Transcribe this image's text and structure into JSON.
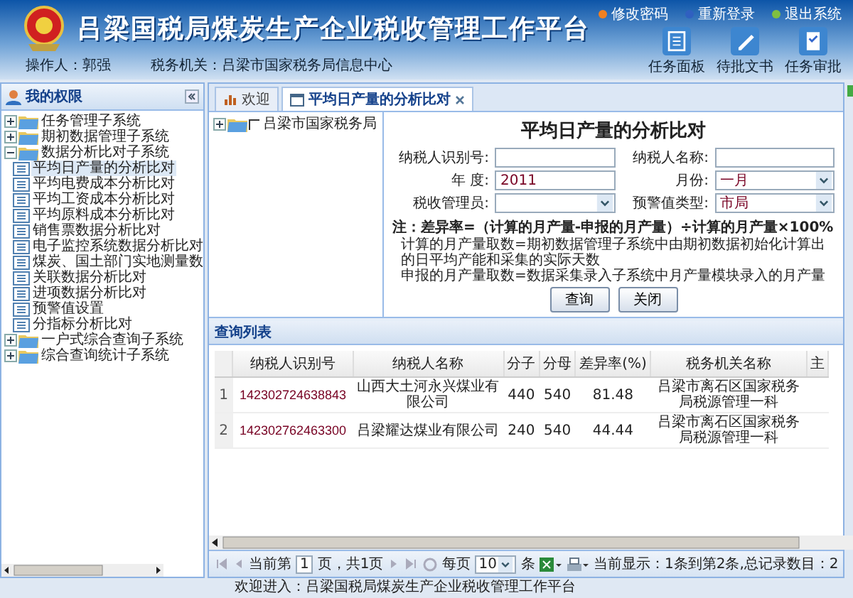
{
  "header": {
    "title": "吕梁国税局煤炭生产企业税收管理工作平台",
    "links": [
      {
        "label": "修改密码",
        "color": "#f08020"
      },
      {
        "label": "重新登录",
        "color": "#3060c0"
      },
      {
        "label": "退出系统",
        "color": "#80c040"
      }
    ],
    "quick_actions": [
      {
        "label": "任务面板"
      },
      {
        "label": "待批文书"
      },
      {
        "label": "任务审批"
      }
    ],
    "operator_label": "操作人：",
    "operator": "郭强",
    "office_label": "税务机关：",
    "office": "吕梁市国家税务局信息中心"
  },
  "sidebar": {
    "title": "我的权限",
    "tree": [
      {
        "label": "任务管理子系统",
        "expanded": false
      },
      {
        "label": "期初数据管理子系统",
        "expanded": false
      },
      {
        "label": "数据分析比对子系统",
        "expanded": true,
        "children": [
          {
            "label": "平均日产量的分析比对",
            "selected": true
          },
          {
            "label": "平均电费成本分析比对",
            "selected": false
          },
          {
            "label": "平均工资成本分析比对",
            "selected": false
          },
          {
            "label": "平均原料成本分析比对",
            "selected": false
          },
          {
            "label": "销售票数据分析比对",
            "selected": false
          },
          {
            "label": "电子监控系统数据分析比对",
            "selected": false
          },
          {
            "label": "煤炭、国土部门实地测量数",
            "selected": false
          },
          {
            "label": "关联数据分析比对",
            "selected": false
          },
          {
            "label": "进项数据分析比对",
            "selected": false
          },
          {
            "label": "预警值设置",
            "selected": false
          },
          {
            "label": "分指标分析比对",
            "selected": false
          }
        ]
      },
      {
        "label": "一户式综合查询子系统",
        "expanded": false
      },
      {
        "label": "综合查询统计子系统",
        "expanded": false
      }
    ]
  },
  "tabs": [
    {
      "label": "欢迎",
      "selected": false
    },
    {
      "label": "平均日产量的分析比对",
      "selected": true
    }
  ],
  "org_tree": {
    "label": "吕梁市国家税务局",
    "expanded": false
  },
  "form": {
    "title": "平均日产量的分析比对",
    "fields": [
      {
        "label": "纳税人识别号:",
        "kind": "text"
      },
      {
        "label": "纳税人名称:",
        "kind": "text"
      },
      {
        "label": "年 度:",
        "kind": "text",
        "value": "2011"
      },
      {
        "label": "月份:",
        "kind": "select",
        "value": "一月"
      },
      {
        "label": "税收管理员:",
        "kind": "select"
      },
      {
        "label": "预警值类型:",
        "kind": "select",
        "value": "市局"
      }
    ],
    "formula": "注：差异率=（计算的月产量-申报的月产量）÷计算的月产量×100%",
    "notes": [
      "计算的月产量取数=期初数据管理子系统中由期初数据初始化计算出的日平均产能和采集的实际天数",
      "申报的月产量取数=数据采集录入子系统中月产量模块录入的月产量"
    ],
    "buttons": [
      "查询",
      "关闭"
    ]
  },
  "list": {
    "title": "查询列表",
    "columns": [
      "纳税人识别号",
      "纳税人名称",
      "分子",
      "分母",
      "差异率(%)",
      "税务机关名称",
      "主"
    ],
    "rows": [
      {
        "number": "1",
        "cells": [
          "142302724638843",
          "山西大土河永兴煤业有限公司",
          "440",
          "540",
          "81.48",
          "吕梁市离石区国家税务局税源管理一科"
        ]
      },
      {
        "number": "2",
        "cells": [
          "142302762463300",
          "吕梁耀达煤业有限公司",
          "240",
          "540",
          "44.44",
          "吕梁市离石区国家税务局税源管理一科"
        ]
      }
    ]
  },
  "pager": {
    "page_prefix": "当前第",
    "page": "1",
    "page_suffix": "页，共1页",
    "per_page_label": "每页",
    "per_page": "10",
    "unit": "条",
    "summary": "当前显示：1条到第2条,总记录数目：2"
  },
  "footer": "欢迎进入：吕梁国税局煤炭生产企业税收管理工作平台"
}
